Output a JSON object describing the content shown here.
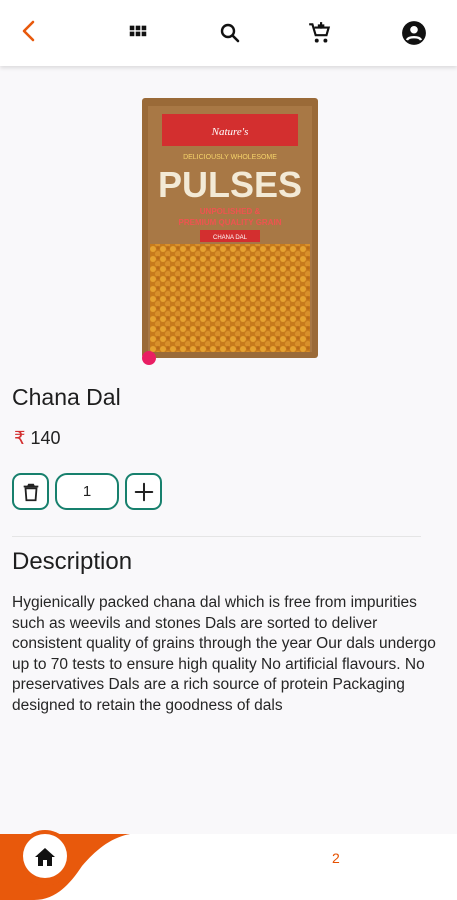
{
  "header": {
    "back_icon": "chevron-left-icon",
    "accent_color": "#e8590c"
  },
  "product": {
    "name": "Chana Dal",
    "currency_symbol": "₹",
    "price": "140",
    "quantity": "1",
    "image": {
      "brand": "Nature's",
      "tagline": "DELICIOUSLY WHOLESOME",
      "title": "PULSES",
      "subtitle_line1": "UNPOLISHED &",
      "subtitle_line2": "PREMIUM QUALITY GRAIN",
      "variant": "CHANA DAL"
    }
  },
  "description": {
    "heading": "Description",
    "text": "Hygienically packed chana dal which is free from impurities such as weevils and stones Dals are sorted to deliver consistent quality of grains through the year Our dals undergo up to 70 tests to ensure high quality No artificial flavours. No preservatives Dals are a rich source of protein Packaging designed to retain the goodness of dals"
  },
  "nav": {
    "items": [
      "home-icon",
      "grid-icon",
      "search-icon",
      "cart-icon",
      "account-icon"
    ],
    "cart_badge": "2"
  }
}
